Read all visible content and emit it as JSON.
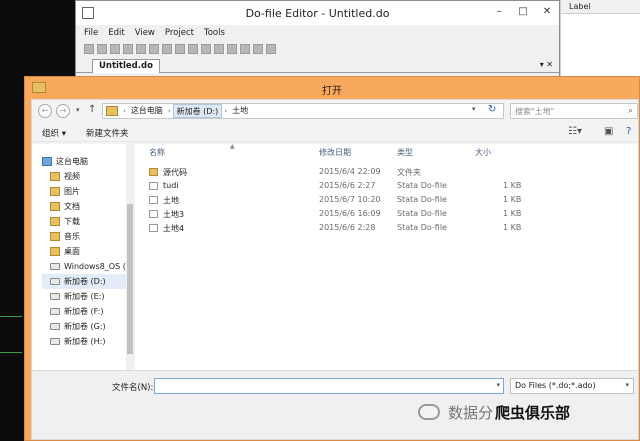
{
  "background_panel": {
    "header_label": "Label"
  },
  "dofile_editor": {
    "title": "Do-file Editor - Untitled.do",
    "menu": [
      "File",
      "Edit",
      "View",
      "Project",
      "Tools"
    ],
    "tab_label": "Untitled.do",
    "window_buttons": {
      "minimize": "–",
      "maximize": "□",
      "close": "✕"
    }
  },
  "dialog": {
    "title": "打开",
    "breadcrumb": [
      "这台电脑",
      "新加卷 (D:)",
      "土地"
    ],
    "search_placeholder": "搜索\"土地\"",
    "toolbar": {
      "organize": "组织 ▾",
      "new_folder": "新建文件夹"
    },
    "nav_tree": [
      {
        "label": "这台电脑",
        "icon": "computer-icon",
        "level": 0
      },
      {
        "label": "视频",
        "icon": "video-folder-icon",
        "level": 1
      },
      {
        "label": "图片",
        "icon": "pictures-folder-icon",
        "level": 1
      },
      {
        "label": "文档",
        "icon": "documents-folder-icon",
        "level": 1
      },
      {
        "label": "下载",
        "icon": "downloads-folder-icon",
        "level": 1
      },
      {
        "label": "音乐",
        "icon": "music-folder-icon",
        "level": 1
      },
      {
        "label": "桌面",
        "icon": "desktop-folder-icon",
        "level": 1
      },
      {
        "label": "Windows8_OS (",
        "icon": "system-drive-icon",
        "level": 1
      },
      {
        "label": "新加卷 (D:)",
        "icon": "drive-icon",
        "level": 1,
        "selected": true
      },
      {
        "label": "新加卷 (E:)",
        "icon": "drive-icon",
        "level": 1
      },
      {
        "label": "新加卷 (F:)",
        "icon": "drive-icon",
        "level": 1
      },
      {
        "label": "新加卷 (G:)",
        "icon": "drive-icon",
        "level": 1
      },
      {
        "label": "新加卷 (H:)",
        "icon": "drive-icon",
        "level": 1
      }
    ],
    "columns": {
      "name": "名称",
      "date": "修改日期",
      "type": "类型",
      "size": "大小"
    },
    "files": [
      {
        "name": "源代码",
        "date": "2015/6/4 22:09",
        "type": "文件夹",
        "size": "",
        "icon": "folder-icon"
      },
      {
        "name": "tudi",
        "date": "2015/6/6 2:27",
        "type": "Stata Do-file",
        "size": "1 KB",
        "icon": "do-file-icon"
      },
      {
        "name": "土地",
        "date": "2015/6/7 10:20",
        "type": "Stata Do-file",
        "size": "1 KB",
        "icon": "do-file-icon"
      },
      {
        "name": "土地3",
        "date": "2015/6/6 16:09",
        "type": "Stata Do-file",
        "size": "1 KB",
        "icon": "do-file-icon"
      },
      {
        "name": "土地4",
        "date": "2015/6/6 2:28",
        "type": "Stata Do-file",
        "size": "1 KB",
        "icon": "do-file-icon"
      }
    ],
    "filename_label": "文件名(N):",
    "filename_value": "",
    "filetype_value": "Do Files (*.do;*.ado)"
  },
  "watermark": {
    "text_a": "数据分",
    "text_b": "爬虫俱乐部"
  },
  "colors": {
    "dialog_frame": "#f8a95e",
    "selection": "#e3edf9",
    "link": "#2060b0"
  }
}
